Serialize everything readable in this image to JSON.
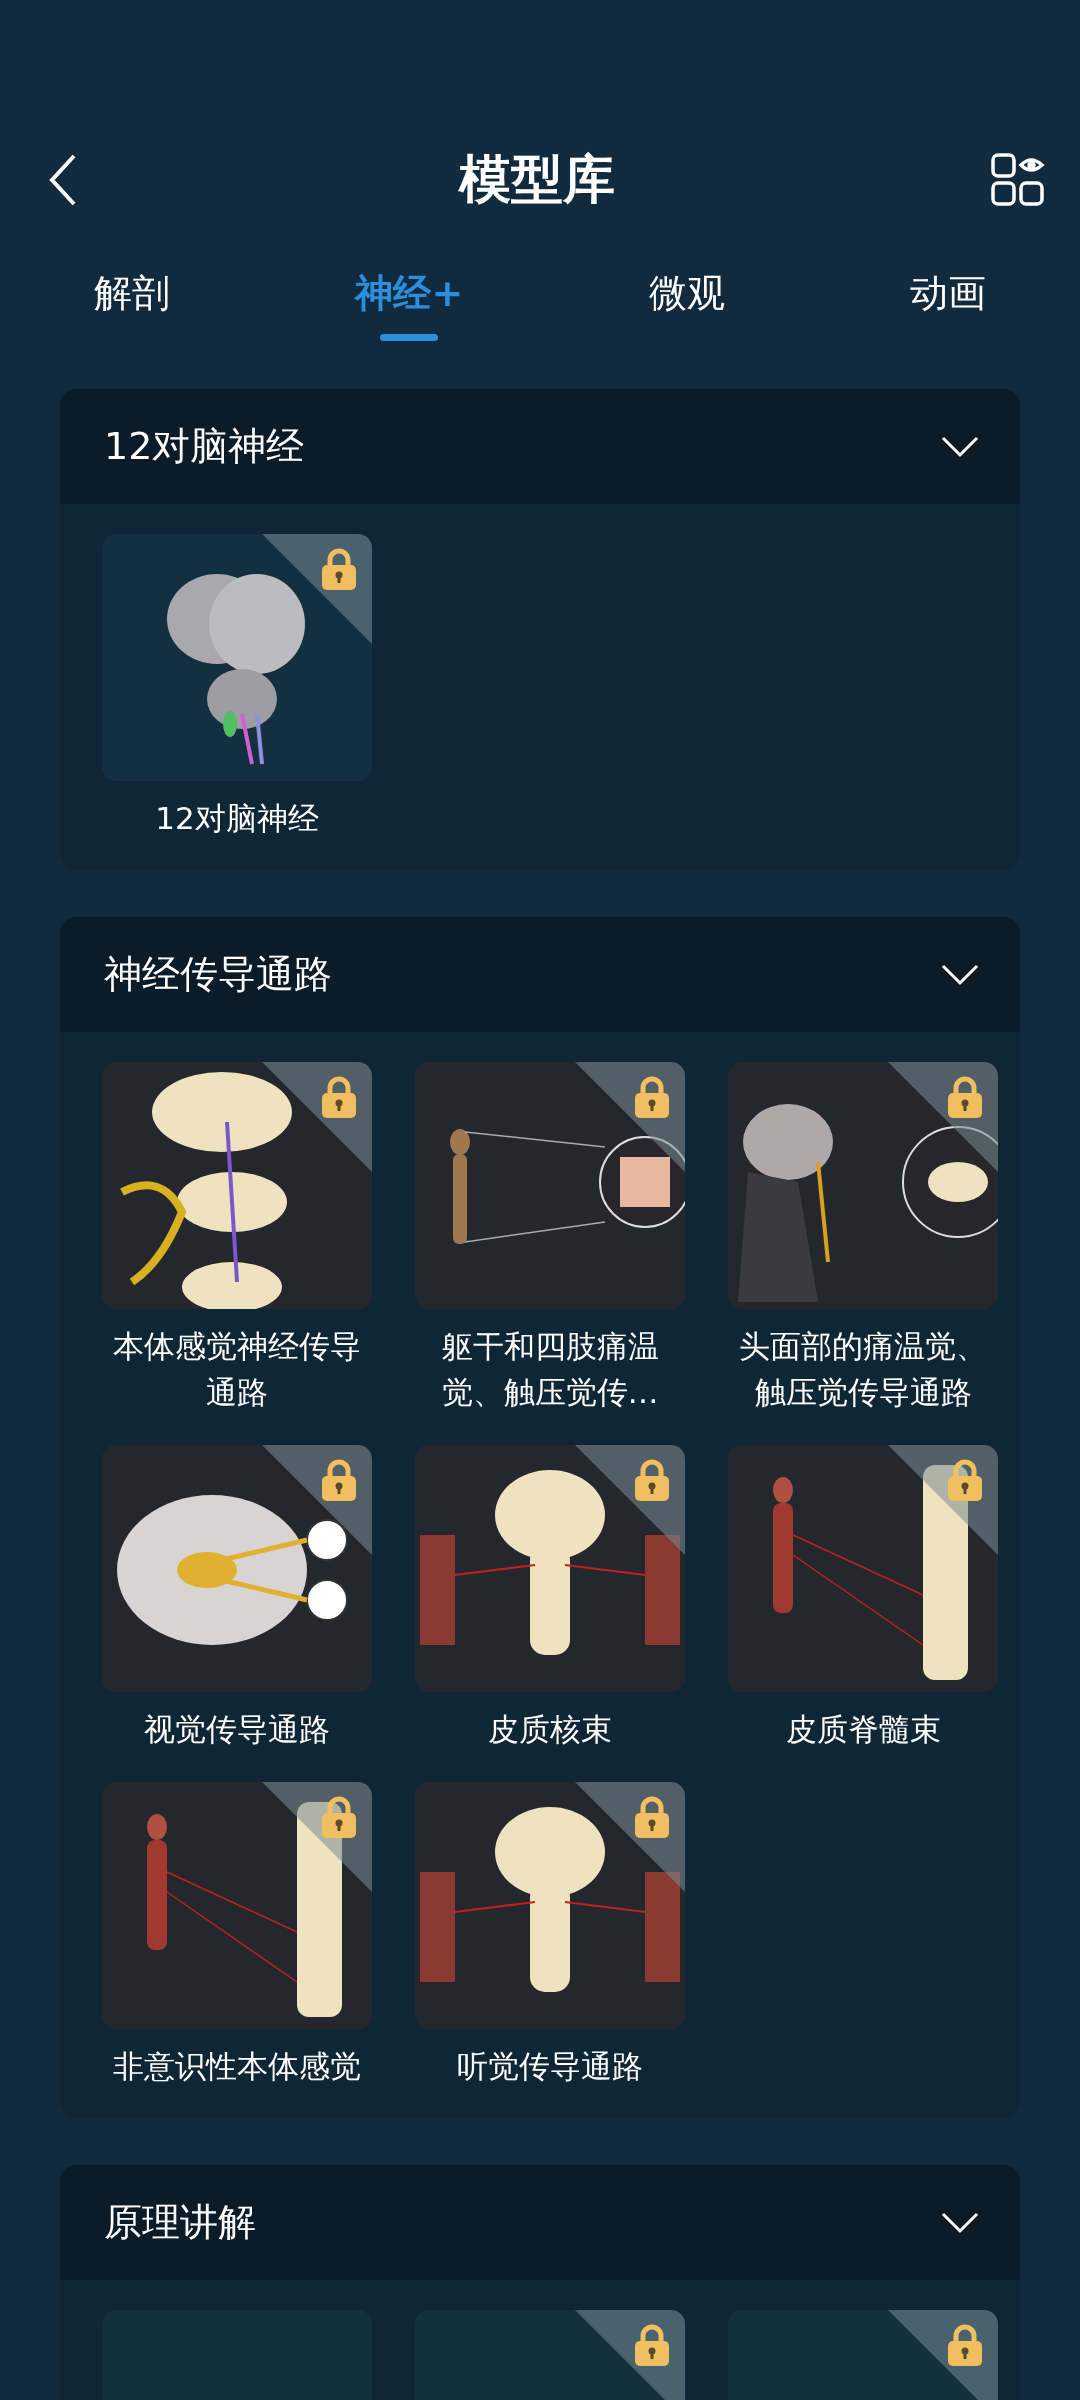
{
  "header": {
    "title": "模型库"
  },
  "tabs": [
    {
      "label": "解剖",
      "selected": false
    },
    {
      "label": "神经+",
      "selected": true
    },
    {
      "label": "微观",
      "selected": false
    },
    {
      "label": "动画",
      "selected": false
    }
  ],
  "sections": [
    {
      "title": "12对脑神经",
      "items": [
        {
          "label": "12对脑神经",
          "locked": true
        }
      ]
    },
    {
      "title": "神经传导通路",
      "items": [
        {
          "label": "本体感觉神经传导通路",
          "locked": true
        },
        {
          "label": "躯干和四肢痛温觉、触压觉传…",
          "locked": true
        },
        {
          "label": "头面部的痛温觉、触压觉传导通路",
          "locked": true
        },
        {
          "label": "视觉传导通路",
          "locked": true
        },
        {
          "label": "皮质核束",
          "locked": true
        },
        {
          "label": "皮质脊髓束",
          "locked": true
        },
        {
          "label": "非意识性本体感觉",
          "locked": true
        },
        {
          "label": "听觉传导通路",
          "locked": true
        }
      ]
    },
    {
      "title": "原理讲解",
      "items": [
        {
          "locked": false
        },
        {
          "locked": true
        },
        {
          "locked": true
        }
      ]
    }
  ]
}
